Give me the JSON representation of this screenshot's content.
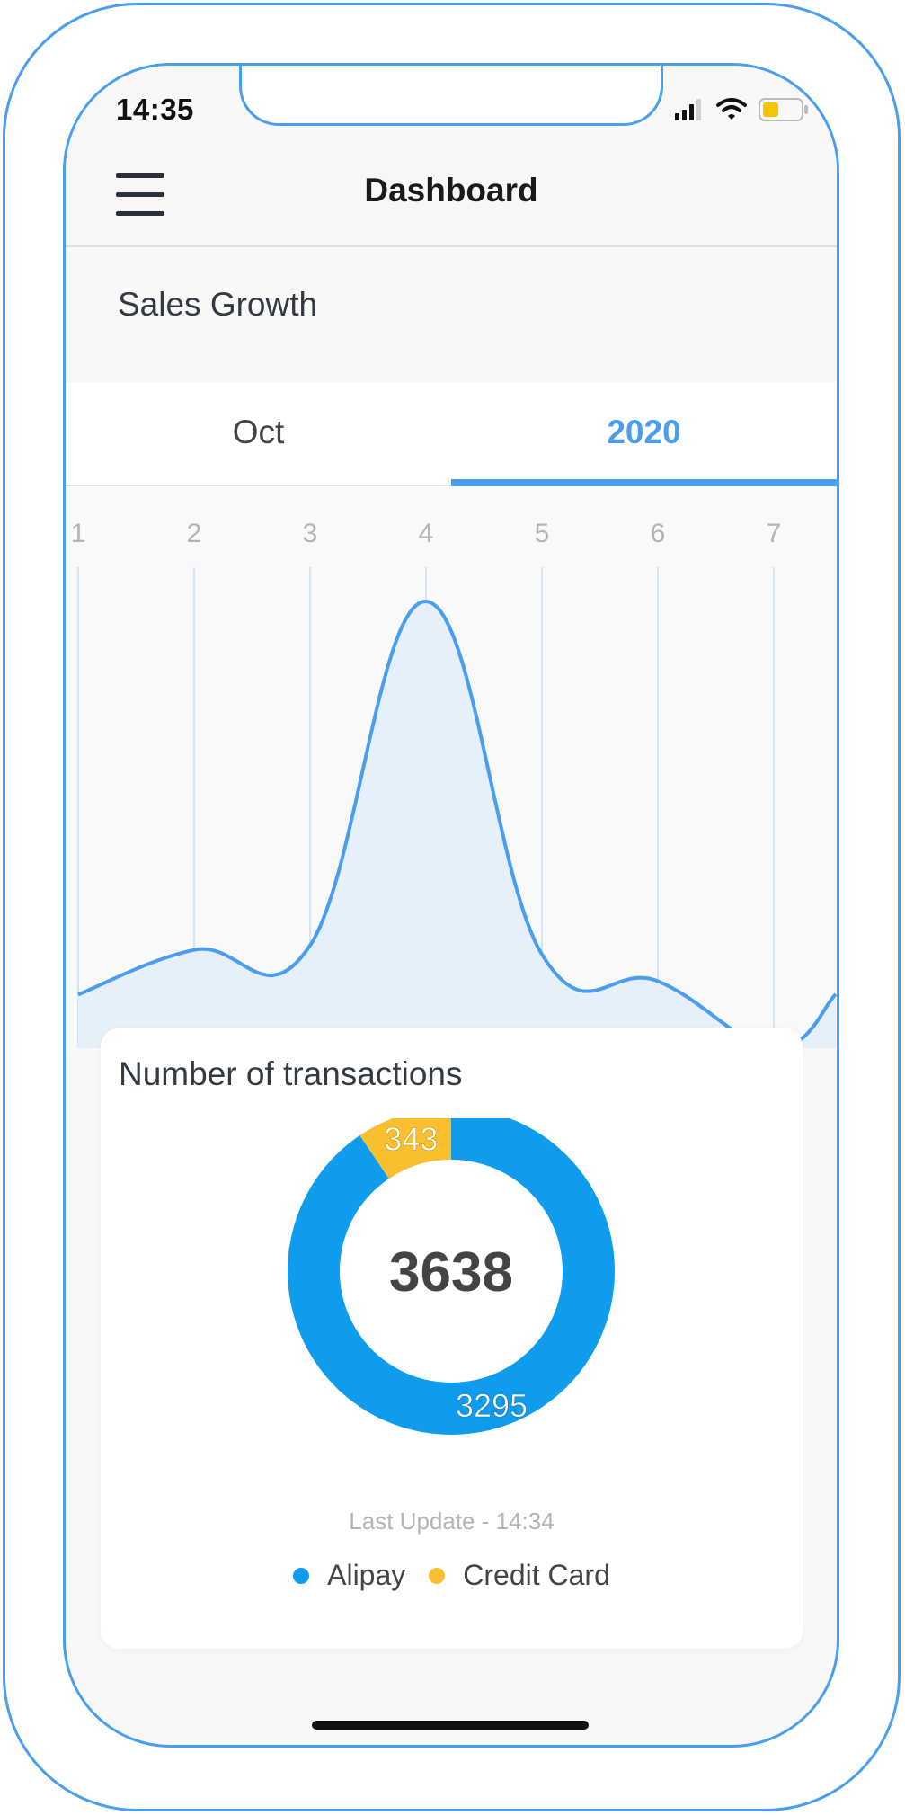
{
  "status_bar": {
    "time": "14:35"
  },
  "nav": {
    "title": "Dashboard"
  },
  "sales": {
    "title": "Sales Growth",
    "tabs": [
      {
        "label": "Oct",
        "active": false
      },
      {
        "label": "2020",
        "active": true
      }
    ]
  },
  "chart_data": [
    {
      "type": "area",
      "x": [
        "1",
        "2",
        "3",
        "4",
        "5",
        "6",
        "7"
      ],
      "values": [
        12,
        22,
        23,
        100,
        21,
        15,
        0
      ],
      "ylim": [
        0,
        100
      ],
      "grid": true,
      "color": "#4a9ef0"
    },
    {
      "type": "pie",
      "title": "Number of transactions",
      "center_label": "3638",
      "categories": [
        "Alipay",
        "Credit Card"
      ],
      "values": [
        3295,
        343
      ],
      "colors": [
        "#109ced",
        "#fabf2f"
      ]
    }
  ],
  "transactions": {
    "title": "Number of transactions",
    "total": "3638",
    "alipay_value": "3295",
    "credit_value": "343",
    "last_update": "Last Update - 14:34",
    "legend": [
      {
        "label": "Alipay",
        "color": "#109ced"
      },
      {
        "label": "Credit Card",
        "color": "#fabf2f"
      }
    ]
  }
}
